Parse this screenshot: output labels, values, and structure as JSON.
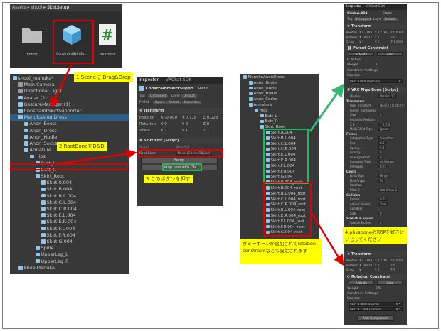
{
  "project": {
    "breadcrumb": [
      "Assets",
      "shool",
      "SkirtSetup"
    ],
    "assets": [
      {
        "label": "Editor",
        "icon": "folder-icon"
      },
      {
        "label": "ConstraintSkirtSu...",
        "icon": "cube-icon"
      },
      {
        "label": "SkirtEdit",
        "icon": "script-icon"
      }
    ]
  },
  "hierarchy_left": {
    "rows": [
      {
        "label": "shool_manuka*",
        "indent": 0,
        "icon": "unity"
      },
      {
        "label": "Main Camera",
        "indent": 1,
        "icon": "gray"
      },
      {
        "label": "Directional Light",
        "indent": 1,
        "icon": "gray"
      },
      {
        "label": "Avatar (2)",
        "indent": 1,
        "icon": "cube"
      },
      {
        "label": "GestureManager (1)",
        "indent": 1,
        "icon": "cube"
      },
      {
        "label": "ConstraintSkirtSupporter",
        "indent": 1,
        "icon": "cube"
      },
      {
        "label": "ManukaAnonDress",
        "indent": 1,
        "icon": "cube",
        "selected": true
      },
      {
        "label": "Anon_Boots",
        "indent": 2,
        "icon": "cube"
      },
      {
        "label": "Anon_Dress",
        "indent": 2,
        "icon": "cube"
      },
      {
        "label": "Anon_Hudie",
        "indent": 2,
        "icon": "cube"
      },
      {
        "label": "Anon_Socks",
        "indent": 2,
        "icon": "cube"
      },
      {
        "label": "Armature",
        "indent": 2,
        "icon": "cube"
      },
      {
        "label": "Hips",
        "indent": 3,
        "icon": "cube"
      },
      {
        "label": "Butt_L",
        "indent": 4,
        "icon": "cube"
      },
      {
        "label": "Butt_R",
        "indent": 4,
        "icon": "cube"
      },
      {
        "label": "Skirt_Root",
        "indent": 4,
        "icon": "cube",
        "boxed": true
      },
      {
        "label": "Skirt.0.004",
        "indent": 5,
        "icon": "cube"
      },
      {
        "label": "Skirt.B.004",
        "indent": 5,
        "icon": "cube"
      },
      {
        "label": "Skirt.B.L.004",
        "indent": 5,
        "icon": "cube"
      },
      {
        "label": "Skirt.C.L.004",
        "indent": 5,
        "icon": "cube"
      },
      {
        "label": "Skirt.C.R.004",
        "indent": 5,
        "icon": "cube"
      },
      {
        "label": "Skirt.E.L.004",
        "indent": 5,
        "icon": "cube"
      },
      {
        "label": "Skirt.E.R.004",
        "indent": 5,
        "icon": "cube"
      },
      {
        "label": "Skirt.F.L.004",
        "indent": 5,
        "icon": "cube"
      },
      {
        "label": "Skirt.F.R.004",
        "indent": 5,
        "icon": "cube"
      },
      {
        "label": "Skirt.G.004",
        "indent": 5,
        "icon": "cube"
      },
      {
        "label": "Spine",
        "indent": 4,
        "icon": "cube"
      },
      {
        "label": "UpperLeg_L",
        "indent": 4,
        "icon": "cube"
      },
      {
        "label": "UpperLeg_R",
        "indent": 4,
        "icon": "cube"
      },
      {
        "label": "ShoolManuka",
        "indent": 1,
        "icon": "cube"
      }
    ]
  },
  "inspector_mid": {
    "tabs": [
      "Inspector",
      "VRChat SDK"
    ],
    "object_name": "ConstraintSkirtSuppo",
    "static_label": "Static",
    "tag_label": "Tag",
    "tag_value": "Untagged",
    "layer_label": "Layer",
    "layer_value": "Default",
    "prefab_label": "Prefab",
    "prefab_open": "Open",
    "prefab_select": "Select",
    "prefab_overrides": "Overrides",
    "transform_title": "Transform",
    "position_label": "Position",
    "rotation_label": "Rotation",
    "scale_label": "Scale",
    "position": [
      "X -0.000",
      "Y 0.718",
      "Z 0.028"
    ],
    "rotation": [
      "X 0",
      "Y 0",
      "Z 0"
    ],
    "scale": [
      "X 1",
      "Y 1",
      "Z 1"
    ],
    "script_title": "Skirt Edit (Script)",
    "script_label": "Script",
    "script_value": "SkirtEdit",
    "rootbone_label": "Root Bone",
    "rootbone_value": "None (Game Object)",
    "setup_btn": "Setup",
    "setup_new_btn": "Setup new with Obj"
  },
  "hierarchy_right": {
    "rows": [
      {
        "label": "ManukaAnonDress",
        "indent": 0
      },
      {
        "label": "Anon_Boots",
        "indent": 1
      },
      {
        "label": "Anon_Dress",
        "indent": 1
      },
      {
        "label": "Anon_Hudie",
        "indent": 1
      },
      {
        "label": "Anon_Socks",
        "indent": 1
      },
      {
        "label": "Armature",
        "indent": 1
      },
      {
        "label": "Hips",
        "indent": 2
      },
      {
        "label": "Butt_L",
        "indent": 3
      },
      {
        "label": "Butt_R",
        "indent": 3
      },
      {
        "label": "Skirt_Root",
        "indent": 3
      },
      {
        "label": "Skirt.A.004",
        "indent": 4
      },
      {
        "label": "Skirt.B.L.004",
        "indent": 4
      },
      {
        "label": "Skirt.C.L.004",
        "indent": 4
      },
      {
        "label": "Skirt.C.R.004",
        "indent": 4
      },
      {
        "label": "Skirt.E.L.004",
        "indent": 4
      },
      {
        "label": "Skirt.E.R.004",
        "indent": 4
      },
      {
        "label": "Skirt.F.L.004",
        "indent": 4
      },
      {
        "label": "Skirt.F.R.004",
        "indent": 4
      },
      {
        "label": "Skirt.G.004",
        "indent": 4
      },
      {
        "label": "Skirt.0.004_root",
        "indent": 4
      },
      {
        "label": "Skirt.B.004_root",
        "indent": 4
      },
      {
        "label": "Skirt.B.L.004_root",
        "indent": 4
      },
      {
        "label": "Skirt.C.L.004_root",
        "indent": 4
      },
      {
        "label": "Skirt.C.R.004_root",
        "indent": 4
      },
      {
        "label": "Skirt.E.L.004_root",
        "indent": 4
      },
      {
        "label": "Skirt.E.R.004_root",
        "indent": 4
      },
      {
        "label": "Skirt.F.L.004_root",
        "indent": 4
      },
      {
        "label": "Skirt.F.R.004_root",
        "indent": 4
      },
      {
        "label": "Skirt.G.004_root",
        "indent": 4
      }
    ]
  },
  "inspector_right": {
    "tabs": [
      "Inspector",
      "VRChat SDK"
    ],
    "object_name": "Skirt.A.004",
    "static_label": "Static",
    "tag_label": "Tag",
    "tag_value": "Untagged",
    "layer_label": "Layer",
    "layer_value": "Default",
    "transform_title": "Transform",
    "position_label": "Position",
    "rotation_label": "Rotation",
    "scale_label": "Scale",
    "position": [
      "X 4.3193",
      "Y 0.7195",
      "Z 0.0066"
    ],
    "rotation": [
      "X 188.27",
      "Y 0",
      "Z 0"
    ],
    "scale": [
      "X 1",
      "Y 1",
      "Z 1.0006"
    ],
    "parent_constraint_title": "Parent Constraint",
    "activate_btn": "Activate",
    "zero_btn": "Zero",
    "is_active_label": "Is Active",
    "weight_label": "Weight",
    "weight_value": "1",
    "constraint_settings_label": "Constraint Settings",
    "sources_label": "Sources",
    "source_value": "Skirt.A.004_root (Trai",
    "source_weight": "1",
    "physbone_title": "VRC Phys Bone (Script)",
    "props": [
      {
        "label": "Version",
        "value": "Version 1.1"
      },
      {
        "label": "Transforms",
        "value": ""
      },
      {
        "label": "Root Transform",
        "value": "None (Transform)"
      },
      {
        "label": "Ignore Transforms",
        "value": ""
      },
      {
        "label": "Size",
        "value": "0"
      },
      {
        "label": "Endpoint Position",
        "value": ""
      },
      {
        "label": "X 0",
        "value": "Y 0   Z 0"
      },
      {
        "label": "Multi Child Type",
        "value": "Ignore"
      },
      {
        "label": "Forces",
        "value": ""
      },
      {
        "label": "Integration Type",
        "value": "Simplified"
      },
      {
        "label": "Pull",
        "value": "0.2"
      },
      {
        "label": "Spring",
        "value": "0.2"
      },
      {
        "label": "Gravity",
        "value": "0"
      },
      {
        "label": "Gravity Falloff",
        "value": "0"
      },
      {
        "label": "Immobile Type",
        "value": "All Motion"
      },
      {
        "label": "Immobile",
        "value": "0.75"
      },
      {
        "label": "Limits",
        "value": ""
      },
      {
        "label": "Limit Type",
        "value": "Hinge"
      },
      {
        "label": "Max Angle",
        "value": "90"
      },
      {
        "label": "Rotation",
        "value": ""
      },
      {
        "label": "Pitch 0",
        "value": "Roll 0   Yaw 0"
      },
      {
        "label": "Collision",
        "value": ""
      },
      {
        "label": "Radius",
        "value": "0.03"
      },
      {
        "label": "Allow Collision",
        "value": "True"
      },
      {
        "label": "Colliders",
        "value": ""
      },
      {
        "label": "Size",
        "value": "0"
      },
      {
        "label": "Stretch & Squish",
        "value": ""
      },
      {
        "label": "Stretch Motion",
        "value": "0"
      }
    ],
    "bottom_transform_title": "Transform",
    "bottom_position": [
      "X 4.3193",
      "Y 0.7195",
      "Z 0.0066"
    ],
    "bottom_rotation": [
      "X 189.29",
      "Y 0",
      "Z 0"
    ],
    "bottom_scale": [
      "X 1",
      "Y 1",
      "Z 1"
    ],
    "rotation_constraint_title": "Rotation Constraint",
    "weight2_value": "0.5",
    "sources2": [
      {
        "name": "Skirt.B.004 (Transfor",
        "w": "0.5"
      },
      {
        "name": "Skirt.B.L.004 (Transfor",
        "w": "0.5"
      }
    ],
    "add_component_btn": "Add Component"
  },
  "callouts": {
    "step1": "1.Sceneに Drag&Drop",
    "step2": "2.RootBoneをD&D",
    "step3": "3.このボタンを押す",
    "step4": "4.physboneの設定を好きにいじってください",
    "note": "ダミーボーンが追加されてrotation constraintなども設定されます"
  },
  "colors": {
    "callout_bg": "#ffff00",
    "highlight_red": "#e00000",
    "highlight_green": "#1db954",
    "arrow_green": "#2eb872",
    "panel_bg": "#383838"
  }
}
